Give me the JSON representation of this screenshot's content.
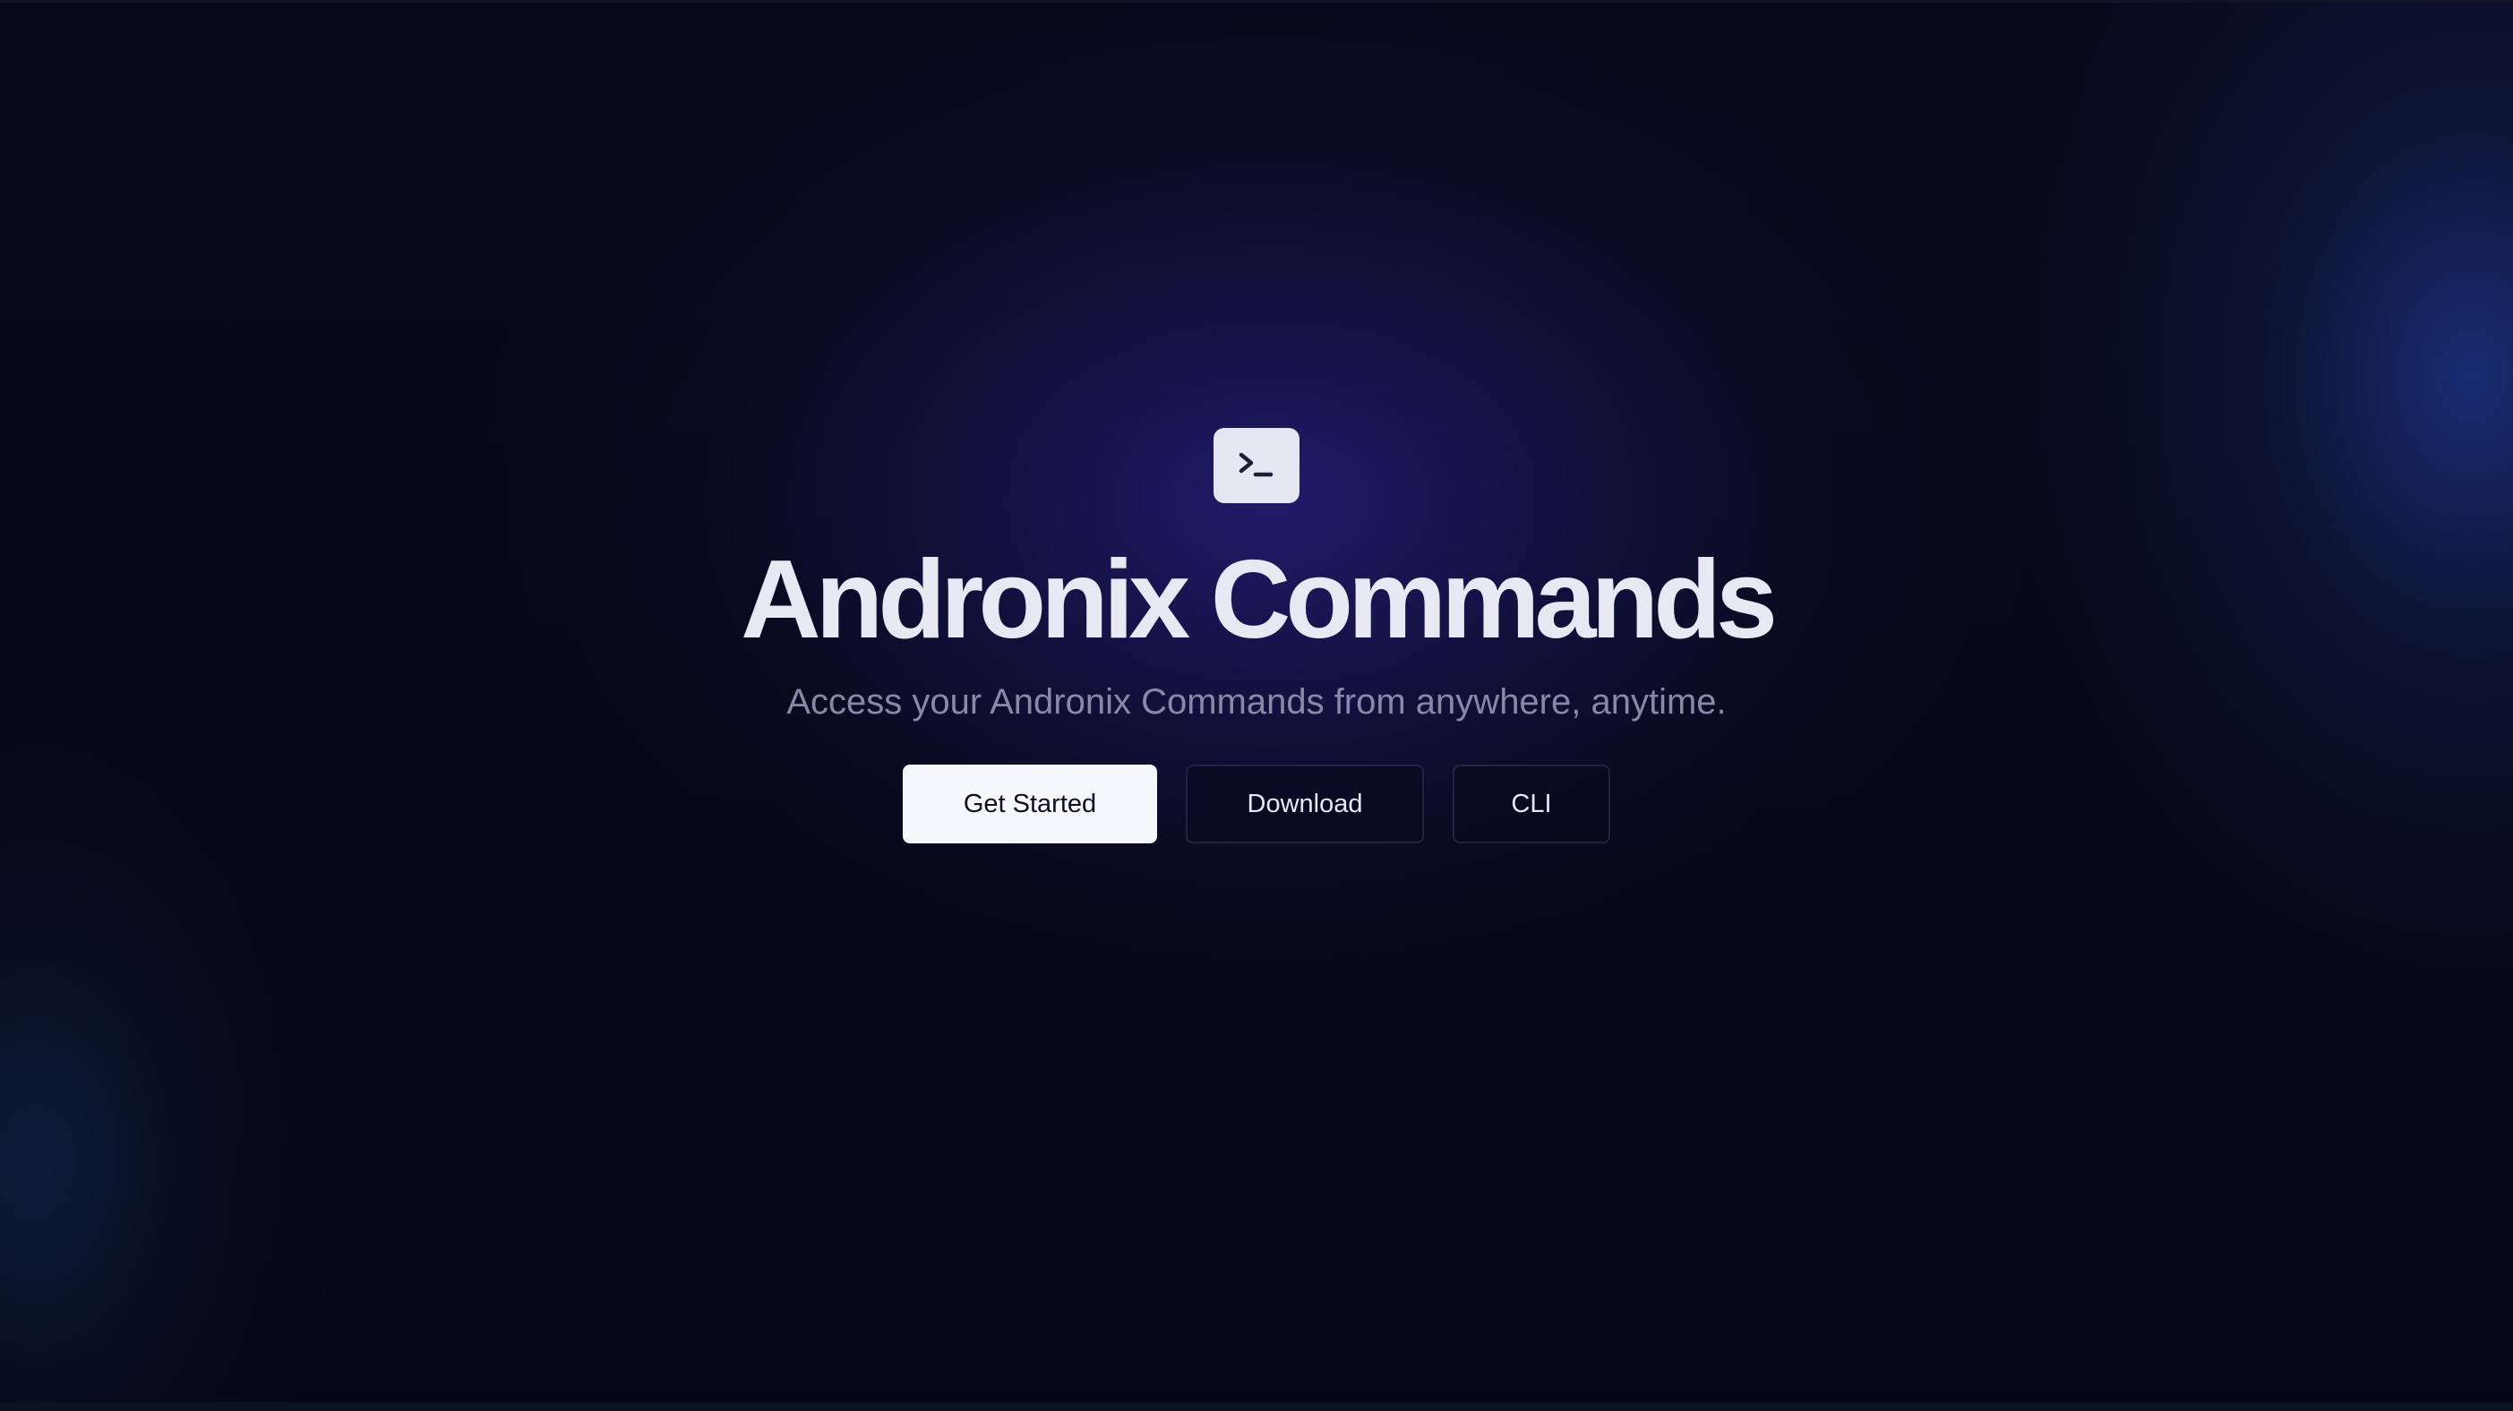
{
  "app": {
    "icon": "terminal-icon",
    "title": "Andronix Commands",
    "subtitle": "Access your Andronix Commands from anywhere, anytime."
  },
  "actions": {
    "get_started_label": "Get Started",
    "download_label": "Download",
    "cli_label": "CLI"
  },
  "colors": {
    "background": "#050814",
    "glow": "#221c6e",
    "accent_light": "#f6f7fb",
    "title_text": "#e6e8f2",
    "subtitle_text": "#858ba6"
  }
}
